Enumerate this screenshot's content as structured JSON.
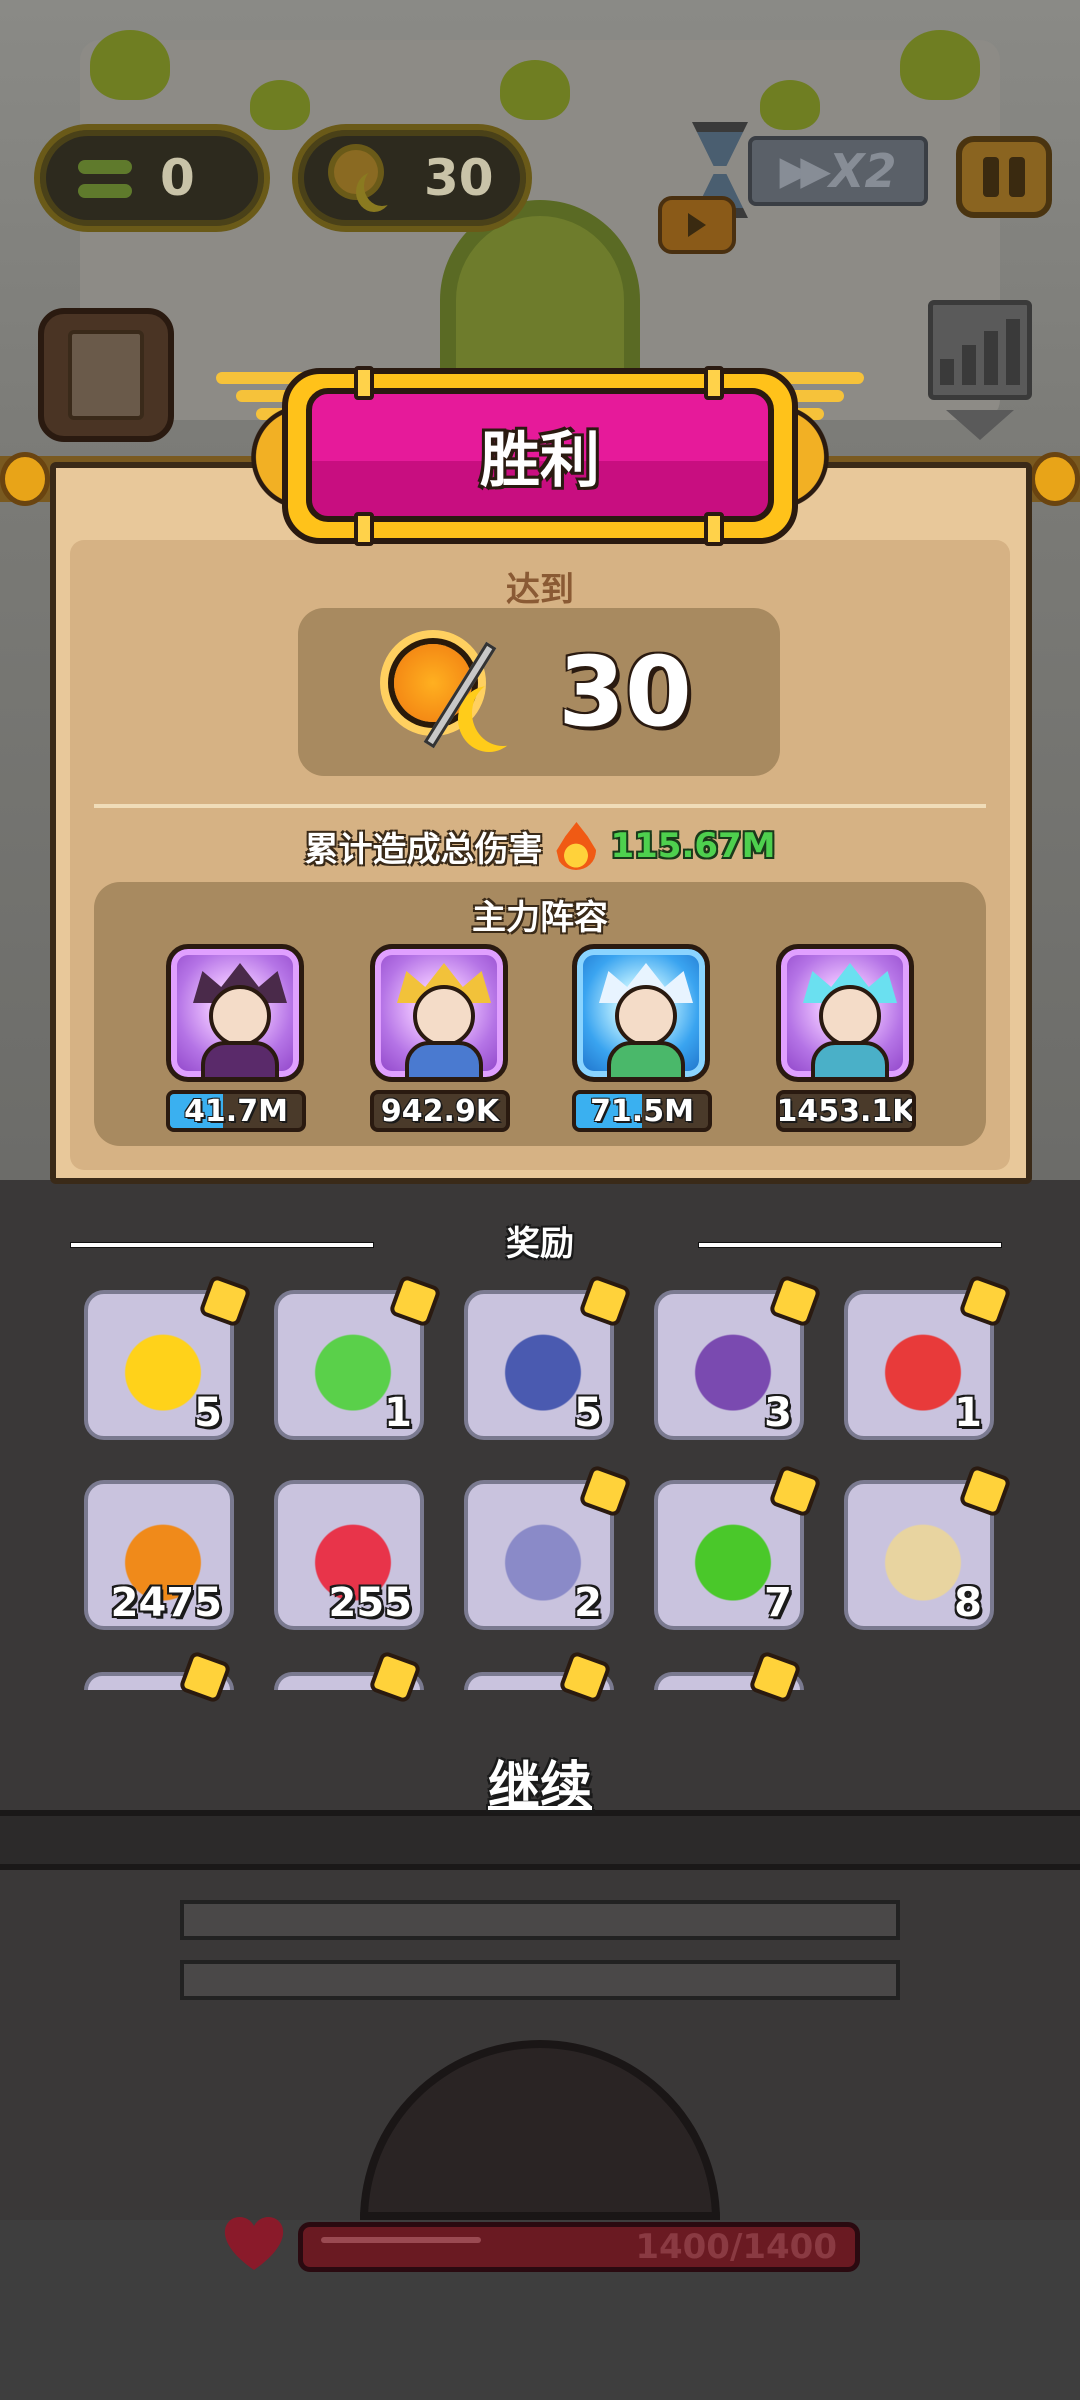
{
  "hud": {
    "swap_count": "0",
    "day_count": "30",
    "speed_label": "X2"
  },
  "victory": {
    "title": "胜利",
    "reach_label": "达到",
    "reach_value": "30",
    "damage_label": "累计造成总伤害",
    "damage_value": "115.67M",
    "lineup_title": "主力阵容",
    "heroes": [
      {
        "power": "41.7M",
        "power_fill": 0.4,
        "frame": "purple"
      },
      {
        "power": "942.9K",
        "power_fill": 0.0,
        "frame": "purple"
      },
      {
        "power": "71.5M",
        "power_fill": 0.5,
        "frame": "blue"
      },
      {
        "power": "1453.1K",
        "power_fill": 0.0,
        "frame": "purple"
      }
    ]
  },
  "rewards": {
    "title": "奖励",
    "items": [
      {
        "name": "yellow-chick-icon",
        "count": "5",
        "puzzle": true,
        "color": "#ffd21a"
      },
      {
        "name": "green-hair-girl-icon",
        "count": "1",
        "puzzle": true,
        "color": "#5ad04a"
      },
      {
        "name": "blue-helmet-icon",
        "count": "5",
        "puzzle": true,
        "color": "#4a5ab0"
      },
      {
        "name": "skull-mage-icon",
        "count": "3",
        "puzzle": true,
        "color": "#7a4ab0"
      },
      {
        "name": "clown-icon",
        "count": "1",
        "puzzle": true,
        "color": "#e83a3a"
      },
      {
        "name": "gold-crown-coin-icon",
        "count": "2475",
        "puzzle": false,
        "color": "#f08a1a"
      },
      {
        "name": "red-shield-icon",
        "count": "255",
        "puzzle": false,
        "color": "#e8344a"
      },
      {
        "name": "purple-robot-icon",
        "count": "2",
        "puzzle": true,
        "color": "#8a8ac8"
      },
      {
        "name": "green-slime-icon",
        "count": "7",
        "puzzle": true,
        "color": "#4ac82a"
      },
      {
        "name": "mummy-icon",
        "count": "8",
        "puzzle": true,
        "color": "#e8d4a0"
      }
    ]
  },
  "continue_label": "继续",
  "base_hp": "1400/1400"
}
